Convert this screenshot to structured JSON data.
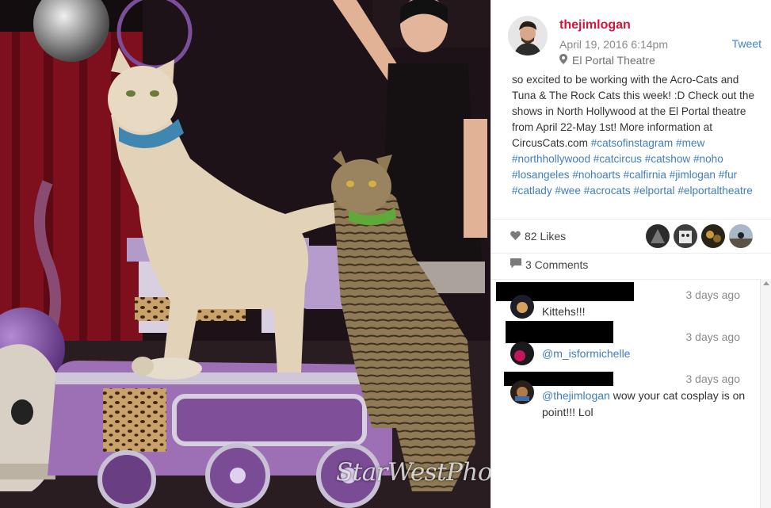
{
  "photo": {
    "watermark": "StarWestPho",
    "colors": {
      "backdrop": "#140d10",
      "curtain": "#8a1020",
      "car_purple": "#9d6fb4"
    }
  },
  "post": {
    "username": "thejimlogan",
    "date": "April 19, 2016 6:14pm",
    "tweet_label": "Tweet",
    "location": "El Portal Theatre",
    "caption_text": "so excited to be working with the Acro-Cats and Tuna & The Rock Cats this week! :D Check out the shows in North Hollywood at the El Portal theatre from April 22-May 1st! More information at CircusCats.com",
    "hashtags": [
      "#catsofinstagram",
      "#mew",
      "#northhollywood",
      "#catcircus",
      "#catshow",
      "#noho",
      "#losangeles",
      "#nohoarts",
      "#calfirnia",
      "#jimlogan",
      "#fur",
      "#catlady",
      "#wee",
      "#acrocats",
      "#elportal",
      "#elportaltheatre"
    ],
    "likes_label": "82 Likes",
    "comments_label": "3 Comments",
    "accent_color": "#d2143a",
    "link_color": "#3f7ebd"
  },
  "comments": [
    {
      "time": "3 days ago",
      "mention": "",
      "text": "Kittehs!!!"
    },
    {
      "time": "3 days ago",
      "mention": "@m_isformichelle",
      "text": ""
    },
    {
      "time": "3 days ago",
      "mention": "@thejimlogan",
      "text": " wow your cat cosplay is on point!!! Lol"
    }
  ],
  "icons": {
    "location": "map-pin-icon",
    "likes": "heart-icon",
    "comments": "comment-bubble-icon"
  }
}
